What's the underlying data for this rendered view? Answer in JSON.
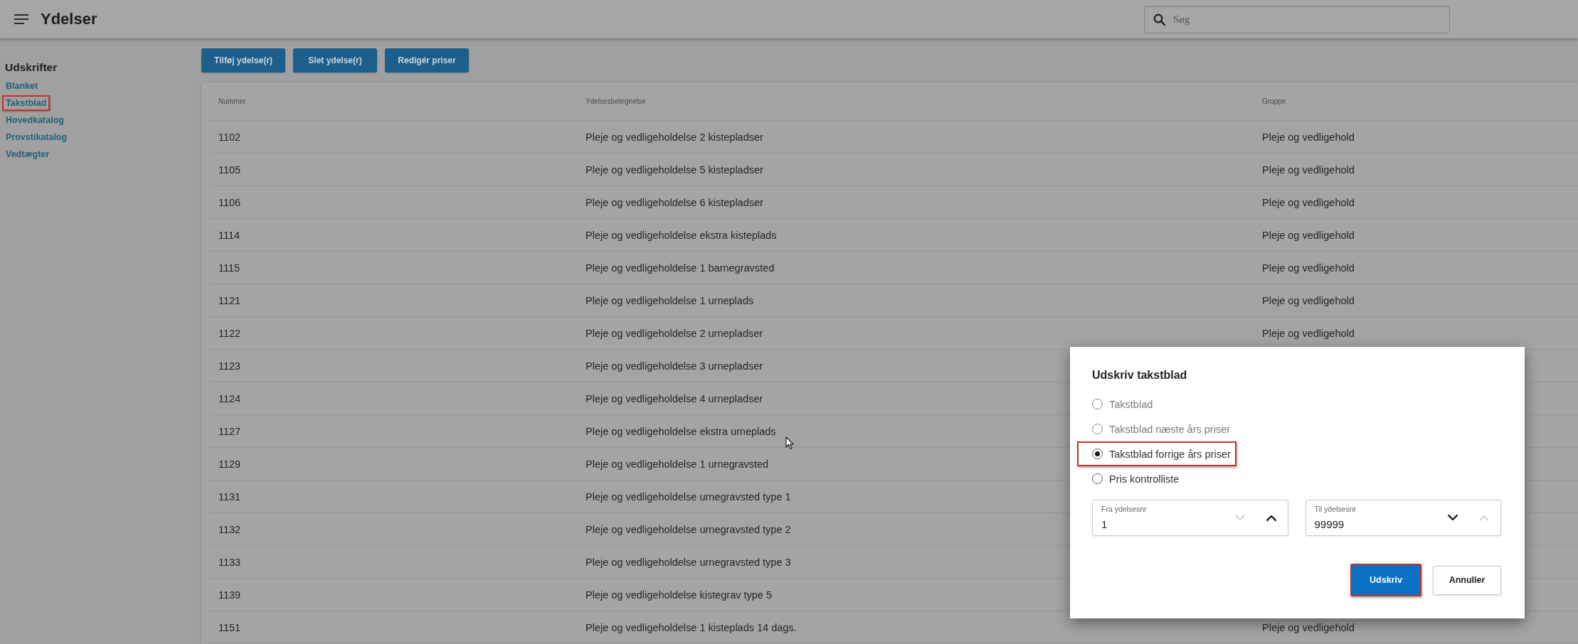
{
  "header": {
    "title": "Ydelser",
    "search": {
      "placeholder": "Søg"
    }
  },
  "sidebar": {
    "heading": "Udskrifter",
    "items": [
      {
        "label": "Blanket",
        "highlighted": false
      },
      {
        "label": "Takstblad",
        "highlighted": true
      },
      {
        "label": "Hovedkatalog",
        "highlighted": false
      },
      {
        "label": "Provstikatalog",
        "highlighted": false
      },
      {
        "label": "Vedtægter",
        "highlighted": false
      }
    ]
  },
  "toolbar": {
    "buttons": [
      "Tilføj ydelse(r)",
      "Slet ydelse(r)",
      "Redigér priser"
    ]
  },
  "table": {
    "columns": [
      "Nummer",
      "Ydelsesbetegnelse",
      "Gruppe"
    ],
    "rows": [
      {
        "number": "1102",
        "name": "Pleje og vedligeholdelse 2 kistepladser",
        "group": "Pleje og vedligehold"
      },
      {
        "number": "1105",
        "name": "Pleje og vedligeholdelse 5 kistepladser",
        "group": "Pleje og vedligehold"
      },
      {
        "number": "1106",
        "name": "Pleje og vedligeholdelse 6 kistepladser",
        "group": "Pleje og vedligehold"
      },
      {
        "number": "1114",
        "name": "Pleje og vedligeholdelse ekstra kisteplads",
        "group": "Pleje og vedligehold"
      },
      {
        "number": "1115",
        "name": "Pleje og vedligeholdelse 1 barnegravsted",
        "group": "Pleje og vedligehold"
      },
      {
        "number": "1121",
        "name": "Pleje og vedligeholdelse 1 urneplads",
        "group": "Pleje og vedligehold"
      },
      {
        "number": "1122",
        "name": "Pleje og vedligeholdelse 2 urnepladser",
        "group": "Pleje og vedligehold"
      },
      {
        "number": "1123",
        "name": "Pleje og vedligeholdelse 3 urnepladser"
      },
      {
        "number": "1124",
        "name": "Pleje og vedligeholdelse 4 urnepladser"
      },
      {
        "number": "1127",
        "name": "Pleje og vedligeholdelse ekstra urneplads"
      },
      {
        "number": "1129",
        "name": "Pleje og vedligeholdelse 1 urnegravsted"
      },
      {
        "number": "1131",
        "name": "Pleje og vedligeholdelse urnegravsted type 1"
      },
      {
        "number": "1132",
        "name": "Pleje og vedligeholdelse urnegravsted type 2"
      },
      {
        "number": "1133",
        "name": "Pleje og vedligeholdelse urnegravsted type 3"
      },
      {
        "number": "1139",
        "name": "Pleje og vedligeholdelse kistegrav type 5"
      },
      {
        "number": "1151",
        "name": "Pleje og vedligeholdelse 1 kisteplads 14 dags.",
        "group": "Pleje og vedligehold"
      }
    ]
  },
  "dialog": {
    "title": "Udskriv takstblad",
    "options": [
      {
        "label": "Takstblad",
        "selected": false,
        "disabled": true,
        "highlighted": false
      },
      {
        "label": "Takstblad næste års priser",
        "selected": false,
        "disabled": true,
        "highlighted": false
      },
      {
        "label": "Takstblad forrige års priser",
        "selected": true,
        "disabled": false,
        "highlighted": true
      },
      {
        "label": "Pris kontrolliste",
        "selected": false,
        "disabled": false,
        "highlighted": false
      }
    ],
    "fields": [
      {
        "label": "Fra ydelsesnr",
        "value": "1",
        "down_disabled": true,
        "up_disabled": false
      },
      {
        "label": "Til ydelsesnr",
        "value": "99999",
        "down_disabled": false,
        "up_disabled": true
      }
    ],
    "buttons": [
      {
        "label": "Udskriv",
        "kind": "primary",
        "highlighted": true
      },
      {
        "label": "Annuller",
        "kind": "secondary",
        "highlighted": false
      }
    ]
  }
}
